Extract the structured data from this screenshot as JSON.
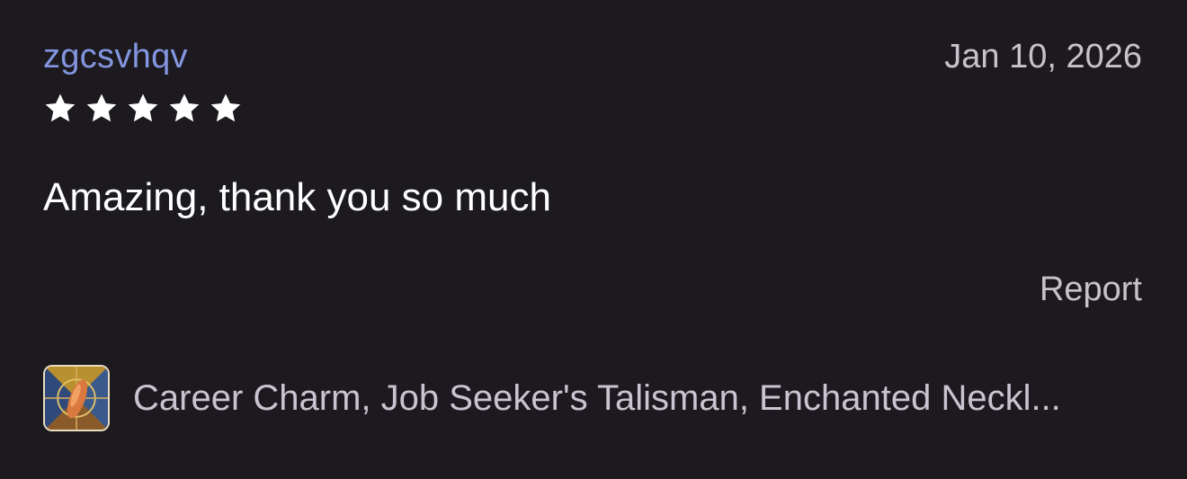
{
  "review": {
    "reviewer_name": "zgcsvhqv",
    "date": "Jan 10, 2026",
    "rating": 5,
    "rating_max": 5,
    "text": "Amazing, thank you so much",
    "report_label": "Report"
  },
  "listing": {
    "title": "Career Charm, Job Seeker's Talisman, Enchanted Neckl...",
    "thumbnail_icon": "talisman-product-thumbnail"
  },
  "colors": {
    "background": "#1c1a1f",
    "reviewer_name": "#8496e0",
    "secondary_text": "#c6c3ca",
    "star": "#ffffff"
  }
}
